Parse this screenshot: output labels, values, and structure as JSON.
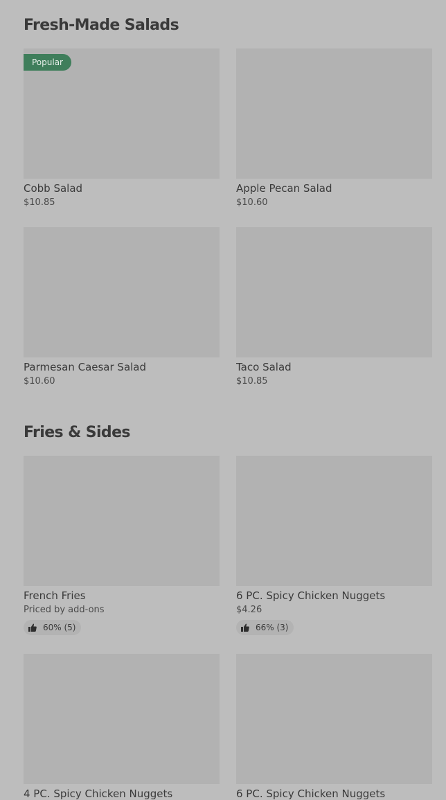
{
  "sections": [
    {
      "title": "Fresh-Made Salads",
      "items": [
        {
          "name": "Cobb Salad",
          "price": "$10.85",
          "badge": "Popular"
        },
        {
          "name": "Apple Pecan Salad",
          "price": "$10.60"
        },
        {
          "name": "Parmesan Caesar Salad",
          "price": "$10.60"
        },
        {
          "name": "Taco Salad",
          "price": "$10.85"
        }
      ]
    },
    {
      "title": "Fries & Sides",
      "items": [
        {
          "name": "French Fries",
          "price": "Priced by add-ons",
          "rating": "60% (5)"
        },
        {
          "name": "6 PC. Spicy Chicken Nuggets",
          "price": "$4.26",
          "rating": "66% (3)"
        },
        {
          "name": "4 PC. Spicy Chicken Nuggets"
        },
        {
          "name": "6 PC. Spicy Chicken Nuggets"
        }
      ]
    }
  ],
  "icons": {
    "rating": "thumbs-up-icon"
  }
}
